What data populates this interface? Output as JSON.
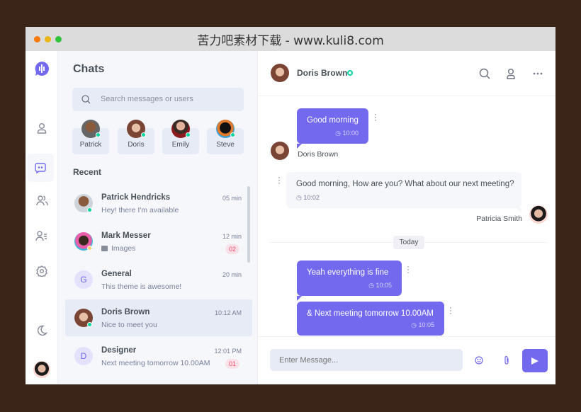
{
  "window": {
    "title": "苦力吧素材下载 - www.kuli8.com",
    "dots": [
      "#f57a0b",
      "#eab619",
      "#2fc23c"
    ]
  },
  "colors": {
    "accent": "#7269ef",
    "online": "#06d6a0",
    "away": "#ffd166",
    "badge": "#ef476f"
  },
  "rail": {
    "icons": [
      "logo-icon",
      "profile-icon",
      "chats-icon",
      "groups-icon",
      "contacts-icon",
      "settings-icon",
      "moon-icon",
      "user-avatar"
    ]
  },
  "chats_panel": {
    "title": "Chats",
    "search_placeholder": "Search messages or users",
    "favorites": [
      {
        "name": "Patrick"
      },
      {
        "name": "Doris"
      },
      {
        "name": "Emily"
      },
      {
        "name": "Steve"
      }
    ],
    "recent_label": "Recent",
    "items": [
      {
        "name": "Patrick Hendricks",
        "message": "Hey! there I'm available",
        "time": "05 min",
        "status": "online"
      },
      {
        "name": "Mark Messer",
        "message": "Images",
        "time": "12 min",
        "badge": "02",
        "status": "away"
      },
      {
        "name": "General",
        "initial": "G",
        "message": "This theme is awesome!",
        "time": "20 min"
      },
      {
        "name": "Doris Brown",
        "message": "Nice to meet you",
        "time": "10:12 AM",
        "status": "online",
        "active": true
      },
      {
        "name": "Designer",
        "initial": "D",
        "message": "Next meeting tomorrow 10.00AM",
        "time": "12:01 PM",
        "badge": "01"
      }
    ]
  },
  "conversation": {
    "contact": "Doris Brown",
    "status": "online",
    "messages": [
      {
        "text": "Good morning",
        "time": "10:00",
        "sender": "Doris Brown"
      },
      {
        "text": "Good morning, How are you? What about our next meeting?",
        "time": "10:02",
        "sender": "Patricia Smith"
      },
      {
        "text": "Yeah everything is fine",
        "time": "10:05"
      },
      {
        "text": "& Next meeting tomorrow 10.00AM",
        "time": "10:05"
      }
    ],
    "divider": "Today",
    "input_placeholder": "Enter Message..."
  }
}
